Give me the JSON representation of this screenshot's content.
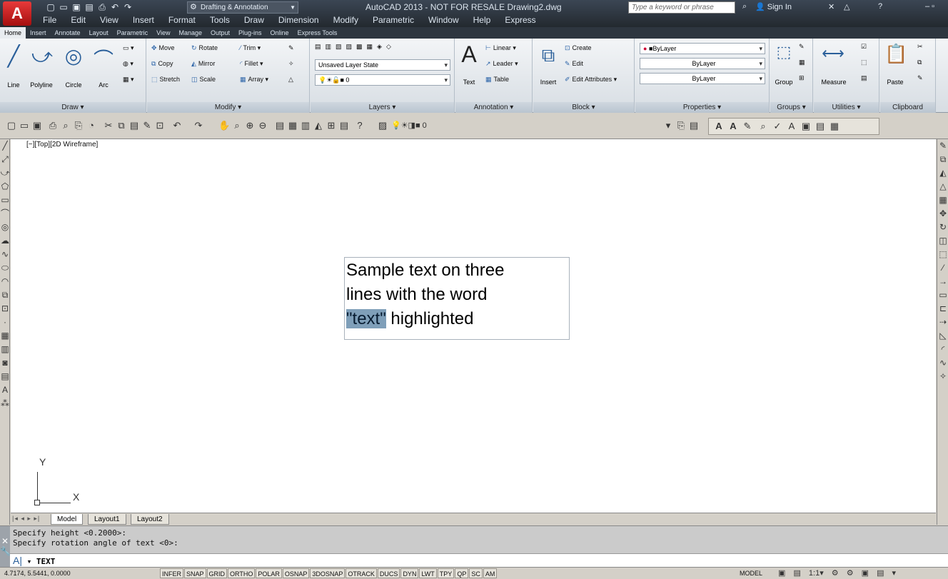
{
  "titlebar": {
    "app_button": "A",
    "workspace": "Drafting & Annotation",
    "title": "AutoCAD 2013 - NOT FOR RESALE   Drawing2.dwg",
    "search_placeholder": "Type a keyword or phrase",
    "sign_in": "Sign In"
  },
  "menu": [
    "File",
    "Edit",
    "View",
    "Insert",
    "Format",
    "Tools",
    "Draw",
    "Dimension",
    "Modify",
    "Parametric",
    "Window",
    "Help",
    "Express"
  ],
  "ribbon_tabs": [
    "Home",
    "Insert",
    "Annotate",
    "Layout",
    "Parametric",
    "View",
    "Manage",
    "Output",
    "Plug-ins",
    "Online",
    "Express Tools"
  ],
  "ribbon": {
    "draw": {
      "title": "Draw ▾",
      "line": "Line",
      "polyline": "Polyline",
      "circle": "Circle",
      "arc": "Arc"
    },
    "modify": {
      "title": "Modify ▾",
      "move": "Move",
      "rotate": "Rotate",
      "trim": "Trim ▾",
      "copy": "Copy",
      "mirror": "Mirror",
      "fillet": "Fillet ▾",
      "stretch": "Stretch",
      "scale": "Scale",
      "array": "Array ▾"
    },
    "layers": {
      "title": "Layers ▾",
      "layer_state": "Unsaved Layer State",
      "layer": "0"
    },
    "annotation": {
      "title": "Annotation ▾",
      "text": "Text",
      "linear": "Linear ▾",
      "leader": "Leader ▾",
      "table": "Table"
    },
    "block": {
      "title": "Block ▾",
      "insert": "Insert",
      "create": "Create",
      "edit": "Edit",
      "edit_attributes": "Edit Attributes ▾"
    },
    "properties": {
      "title": "Properties ▾",
      "color": "ByLayer",
      "linetype": "ByLayer",
      "lineweight": "ByLayer"
    },
    "groups": {
      "title": "Groups ▾",
      "group": "Group"
    },
    "utilities": {
      "title": "Utilities ▾",
      "measure": "Measure"
    },
    "clipboard": {
      "title": "Clipboard",
      "paste": "Paste"
    }
  },
  "toolbar": {
    "layer": "0"
  },
  "drawing": {
    "viewport_label": "[−][Top][2D Wireframe]",
    "text_line1": "Sample text on three",
    "text_line2": "lines with the word",
    "text_highlight": "\"text\"",
    "text_line3_rest": " highlighted",
    "ucs_x": "X",
    "ucs_y": "Y"
  },
  "layout_tabs": [
    "Model",
    "Layout1",
    "Layout2"
  ],
  "command": {
    "history": [
      "Specify height <0.2000>:",
      "Specify rotation angle of text <0>:"
    ],
    "current": "TEXT"
  },
  "status": {
    "coords": "4.7174, 5.5441, 0.0000",
    "toggles": [
      "INFER",
      "SNAP",
      "GRID",
      "ORTHO",
      "POLAR",
      "OSNAP",
      "3DOSNAP",
      "OTRACK",
      "DUCS",
      "DYN",
      "LWT",
      "TPY",
      "QP",
      "SC",
      "AM"
    ],
    "space": "MODEL",
    "scale": "1:1"
  },
  "colors": {
    "title_bg": "#2b323a",
    "text_highlight": "#7f9fb9",
    "canvas": "#ffffff"
  }
}
